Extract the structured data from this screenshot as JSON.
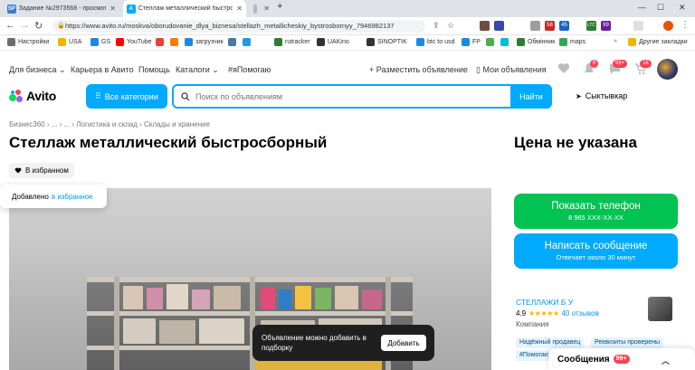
{
  "browser": {
    "tabs": [
      {
        "label": "Задание №2973568 - просмотр з",
        "favicon_text": "SP",
        "color": "#3a7bd5"
      },
      {
        "label": "Стеллаж металлический быстрос",
        "favicon_text": "A",
        "color": "#00aaff"
      },
      {
        "label": "",
        "favicon_text": "",
        "color": "#b0b6bc"
      }
    ],
    "new_tab": "+",
    "window_controls": {
      "minimize": "—",
      "maximize": "☐",
      "close": "✕"
    },
    "url": "https://www.avito.ru/moskva/oborudovanie_dlya_biznesa/stellazh_metallicheskiy_bystrosbornyy_7946982137",
    "extensions": [
      {
        "label": "58",
        "color": "#c62828"
      },
      {
        "label": "45",
        "color": "#1565c0"
      },
      {
        "label": "LTC",
        "color": "#2e7d32"
      },
      {
        "label": "99",
        "color": "#6a1b9a"
      }
    ],
    "bookmarks": [
      {
        "label": "Настройки",
        "color": "#6d6d6d"
      },
      {
        "label": "USA",
        "color": "#f2b300"
      },
      {
        "label": "GS",
        "color": "#1e88e5"
      },
      {
        "label": "YouTube",
        "color": "#ff0000"
      },
      {
        "label": "",
        "color": "#ea4335"
      },
      {
        "label": "",
        "color": "#f57c00"
      },
      {
        "label": "загрузчик",
        "color": "#1e88e5"
      },
      {
        "label": "",
        "color": "#4a76a8"
      },
      {
        "label": "",
        "color": "#2196f3"
      },
      {
        "label": "rutracker",
        "color": "#2e7d32"
      },
      {
        "label": "UAKino",
        "color": "#333333"
      },
      {
        "label": "SINOPTIK",
        "color": "#333333"
      },
      {
        "label": "btc to usd",
        "color": "#1e88e5"
      },
      {
        "label": "FP",
        "color": "#1e88e5"
      },
      {
        "label": "",
        "color": "#4caf50"
      },
      {
        "label": "",
        "color": "#00bcd4"
      },
      {
        "label": "Обмінник",
        "color": "#2e7d32"
      },
      {
        "label": "maps",
        "color": "#34a853"
      },
      {
        "label": "Другие закладки",
        "color": "#f2b300"
      }
    ]
  },
  "topnav": {
    "for_business": "Для бизнеса",
    "career": "Карьера в Авито",
    "help": "Помощь",
    "catalogs": "Каталоги",
    "ipomogau": "#яПомогаю",
    "post_ad": "Разместить объявление",
    "my_ads": "Мои объявления",
    "badge_notifications": "6",
    "badge_messages": "99+",
    "badge_cart": "16"
  },
  "header": {
    "logo": "Avito",
    "categories": "Все категории",
    "search_placeholder": "Поиск по объявлениям",
    "search_button": "Найти",
    "location": "Сыктывкар"
  },
  "listing": {
    "breadcrumb": "Бизнес360 › ... › ... › Логистика и склад › Склады и хранение",
    "title": "Стеллаж металлический быстросборный",
    "favorite_button": "В избранном",
    "toast_added": "Добавлено",
    "toast_link": "в избранное",
    "price": "Цена не указана"
  },
  "contact": {
    "phone_label": "Показать телефон",
    "phone_number": "8 965 XXX-XX-XX",
    "message_label": "Написать сообщение",
    "message_sub": "Отвечает около 30 минут"
  },
  "seller": {
    "name": "СТЕЛЛАЖИ Б У",
    "rating": "4.9",
    "stars": "★★★★★",
    "reviews": "40 отзывов",
    "type": "Компания",
    "badges": [
      "Надёжный продавец",
      "Реквизиты проверены",
      "#Помогаю"
    ]
  },
  "selection_toast": {
    "message": "Объявление можно добавить в подборку",
    "button": "Добавить"
  },
  "messages_widget": {
    "label": "Сообщения",
    "count": "99+"
  }
}
